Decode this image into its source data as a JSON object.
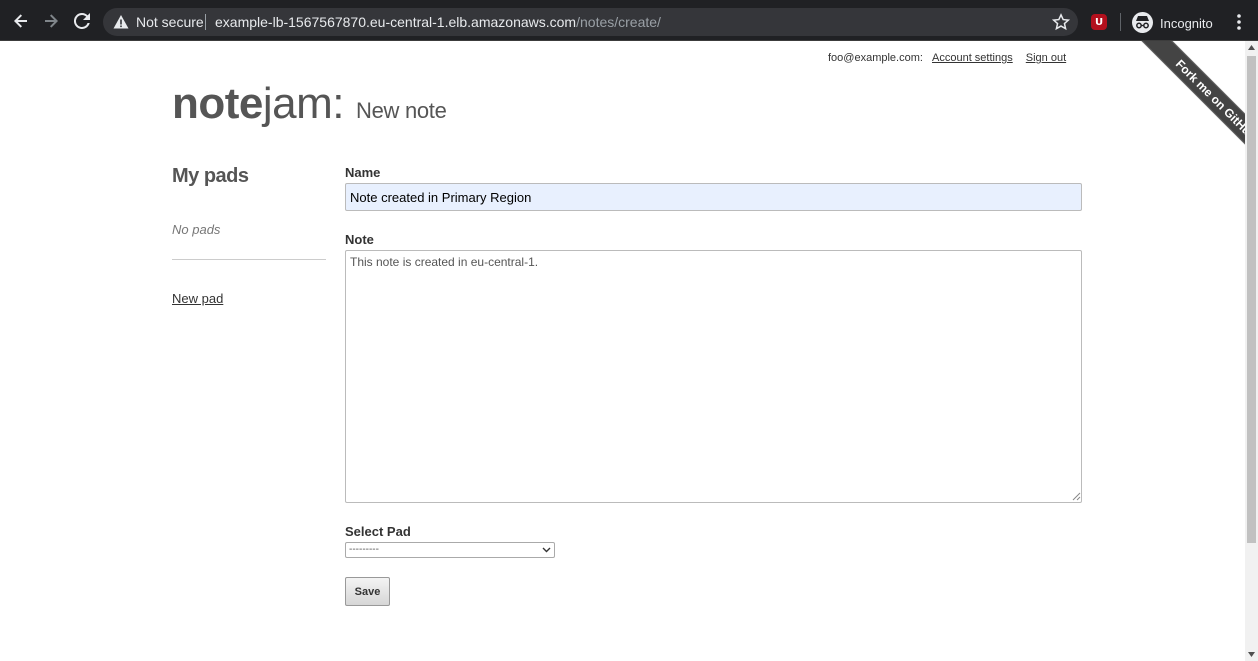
{
  "browser": {
    "security_label": "Not secure",
    "url_host": "example-lb-1567567870.eu-central-1.elb.amazonaws.com",
    "url_path": "/notes/create/",
    "extension_badge": "U",
    "profile_label": "Incognito"
  },
  "header": {
    "user_email": "foo@example.com:",
    "account_settings": "Account settings",
    "sign_out": "Sign out",
    "logo_bold": "note",
    "logo_light": "jam:",
    "page_subtitle": "New note",
    "github_ribbon": "Fork me on GitHub"
  },
  "sidebar": {
    "title": "My pads",
    "empty_text": "No pads",
    "new_pad": "New pad"
  },
  "form": {
    "name_label": "Name",
    "name_value": "Note created in Primary Region",
    "note_label": "Note",
    "note_value": "This note is created in eu-central-1.",
    "pad_label": "Select Pad",
    "pad_selected": "---------",
    "save_label": "Save"
  },
  "colors": {
    "chrome_bg": "#202124",
    "omnibox_bg": "#35363a",
    "autofill_bg": "#e8f0fe",
    "ribbon_bg": "#444444",
    "extension_red": "#b3101d"
  }
}
